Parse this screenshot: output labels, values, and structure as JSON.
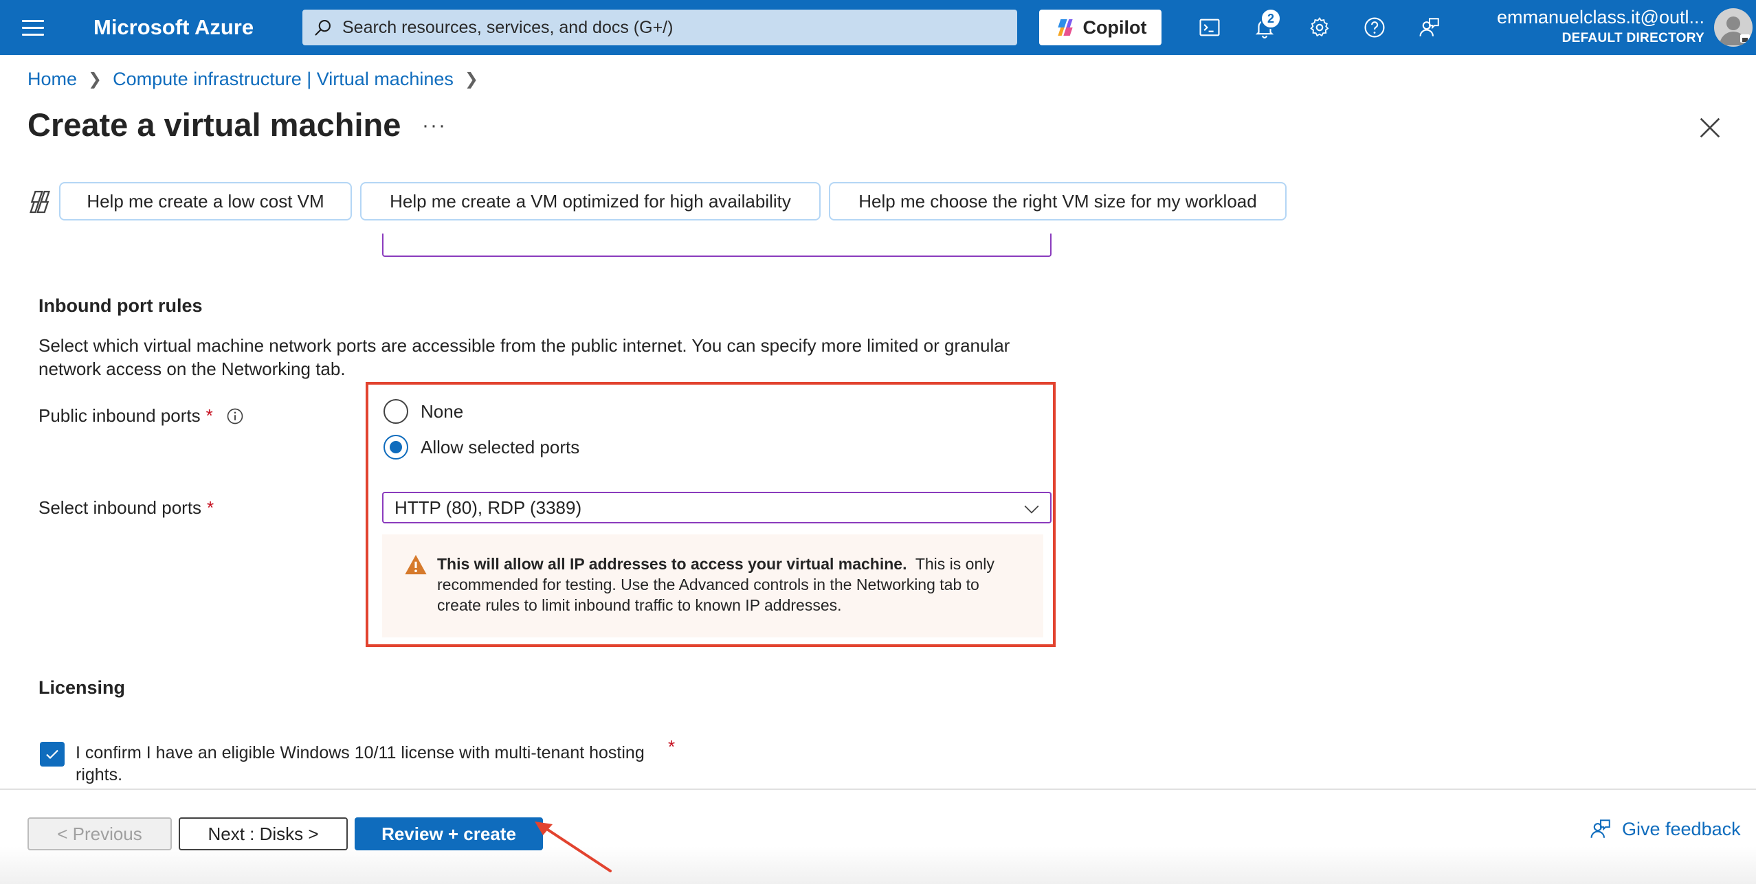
{
  "topbar": {
    "brand": "Microsoft Azure",
    "search_placeholder": "Search resources, services, and docs (G+/)",
    "copilot_label": "Copilot",
    "notification_count": "2",
    "account_email": "emmanuelclass.it@outl...",
    "account_directory": "DEFAULT DIRECTORY"
  },
  "breadcrumb": {
    "items": [
      "Home",
      "Compute infrastructure | Virtual machines"
    ]
  },
  "page": {
    "title": "Create a virtual machine",
    "more_label": "···"
  },
  "suggestions": [
    "Help me create a low cost VM",
    "Help me create a VM optimized for high availability",
    "Help me choose the right VM size for my workload"
  ],
  "inbound": {
    "heading": "Inbound port rules",
    "description": "Select which virtual machine network ports are accessible from the public internet. You can specify more limited or granular network access on the Networking tab.",
    "public_ports_label": "Public inbound ports",
    "required_mark": "*",
    "options": [
      "None",
      "Allow selected ports"
    ],
    "selected_option": "Allow selected ports",
    "select_ports_label": "Select inbound ports",
    "selected_ports": "HTTP (80), RDP (3389)",
    "warning_bold": "This will allow all IP addresses to access your virtual machine.",
    "warning_text": "This is only recommended for testing.  Use the Advanced controls in the Networking tab to create rules to limit inbound traffic to known IP addresses."
  },
  "licensing": {
    "heading": "Licensing",
    "confirm_text": "I confirm I have an eligible Windows 10/11 license with multi-tenant hosting rights.",
    "confirm_checked": true,
    "required_mark": "*"
  },
  "footer": {
    "previous_label": "< Previous",
    "next_label": "Next : Disks >",
    "review_label": "Review + create",
    "feedback_label": "Give feedback"
  },
  "colors": {
    "azure_blue": "#0f6cbd",
    "highlight_red": "#e2432f",
    "warning_orange": "#d67a2c"
  }
}
